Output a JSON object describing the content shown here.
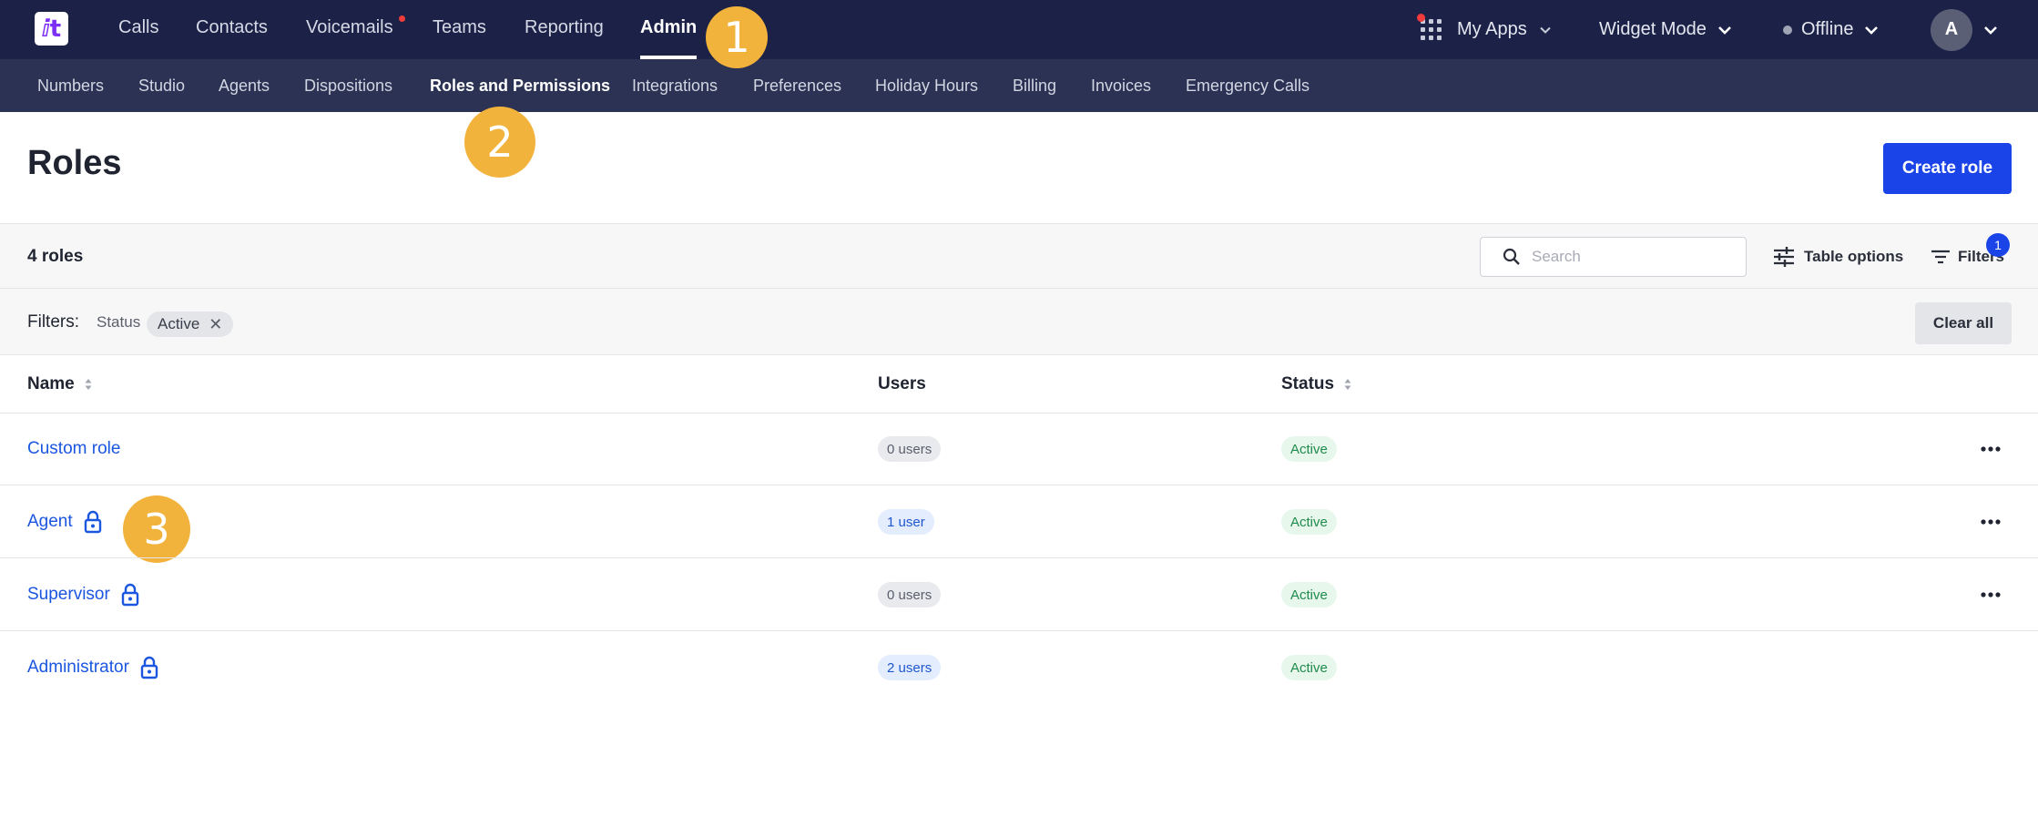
{
  "topnav": {
    "items": [
      {
        "label": "Calls"
      },
      {
        "label": "Contacts"
      },
      {
        "label": "Voicemails"
      },
      {
        "label": "Teams"
      },
      {
        "label": "Reporting"
      },
      {
        "label": "Admin"
      }
    ],
    "my_apps": "My Apps",
    "widget_mode": "Widget Mode",
    "status": "Offline",
    "avatar_initial": "A"
  },
  "subnav": {
    "items": [
      {
        "label": "Numbers"
      },
      {
        "label": "Studio"
      },
      {
        "label": "Agents"
      },
      {
        "label": "Dispositions"
      },
      {
        "label": "Roles and Permissions"
      },
      {
        "label": "Integrations"
      },
      {
        "label": "Preferences"
      },
      {
        "label": "Holiday Hours"
      },
      {
        "label": "Billing"
      },
      {
        "label": "Invoices"
      },
      {
        "label": "Emergency Calls"
      }
    ]
  },
  "markers": [
    "1",
    "2",
    "3"
  ],
  "page": {
    "title": "Roles",
    "create_button": "Create role"
  },
  "toolbar": {
    "count": "4 roles",
    "search_placeholder": "Search",
    "table_options": "Table options",
    "filters": "Filters",
    "filters_badge": "1"
  },
  "filters_bar": {
    "label": "Filters:",
    "key": "Status",
    "chip": "Active",
    "chip_remove": "✕",
    "clear_all": "Clear all"
  },
  "table": {
    "headers": {
      "name": "Name",
      "users": "Users",
      "status": "Status"
    },
    "rows": [
      {
        "name": "Custom role",
        "users": "0 users",
        "status": "Active"
      },
      {
        "name": "Agent",
        "users": "1 user",
        "status": "Active"
      },
      {
        "name": "Supervisor",
        "users": "0 users",
        "status": "Active"
      },
      {
        "name": "Administrator",
        "users": "2 users",
        "status": "Active"
      }
    ]
  },
  "colors": {
    "nav_bg": "#1c2247",
    "subnav_bg": "#2b3253",
    "primary": "#1a44e8",
    "marker": "#f2b33d",
    "link": "#1a56e0"
  },
  "icons": {
    "apps": "grid-icon",
    "search": "search-icon",
    "table_options": "sliders-icon",
    "filters": "filter-icon",
    "lock": "lock-icon",
    "more": "ellipsis-icon",
    "sort": "sort-icon"
  }
}
